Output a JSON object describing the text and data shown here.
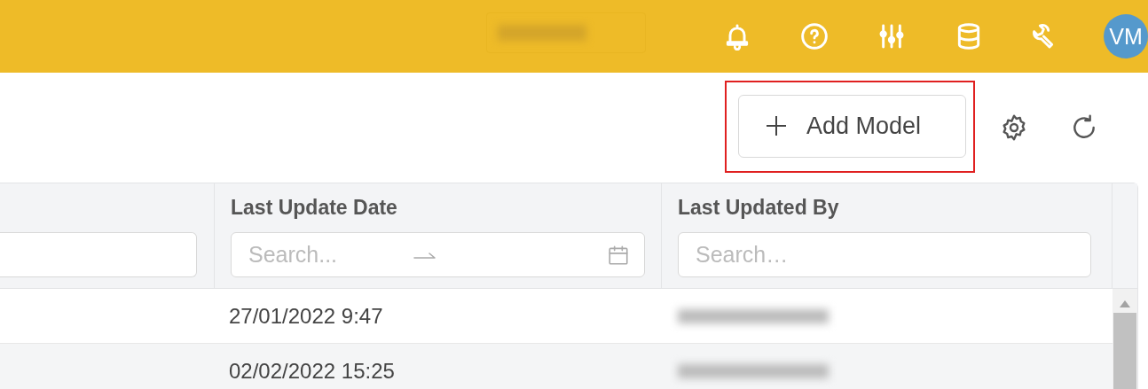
{
  "top_bar": {
    "avatar": {
      "initials": "VM",
      "color": "#5599cc"
    }
  },
  "toolbar": {
    "add_button": {
      "label": "Add Model",
      "highlighted": true
    }
  },
  "table": {
    "columns": [
      {
        "kind": "text"
      },
      {
        "kind": "date_range",
        "title": "Last Update Date",
        "placeholder": "Search..."
      },
      {
        "kind": "text",
        "title": "Last Updated By",
        "placeholder": "Search…"
      }
    ],
    "rows": [
      {
        "last_update_date": "27/01/2022 9:47"
      },
      {
        "last_update_date": "02/02/2022 15:25"
      }
    ]
  }
}
